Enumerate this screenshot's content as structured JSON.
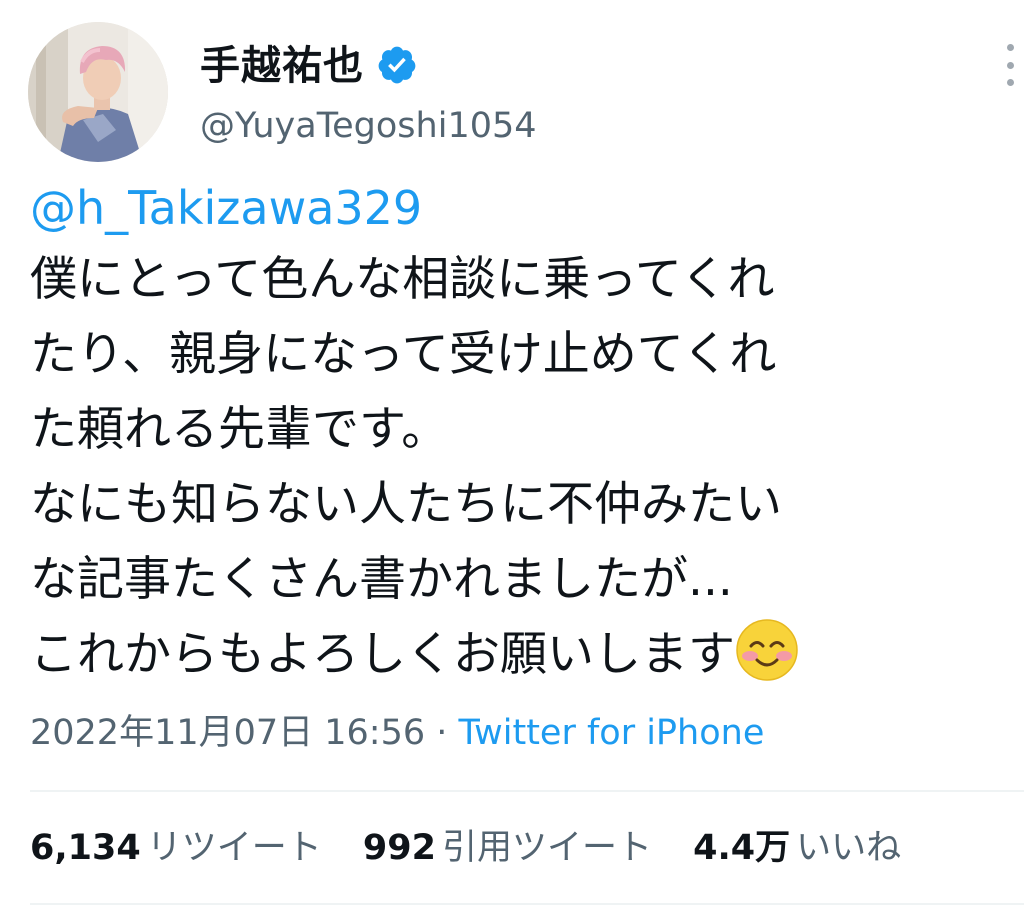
{
  "user": {
    "display_name": "手越祐也",
    "handle": "@YuyaTegoshi1054",
    "verified": true,
    "verified_icon": "verified-badge-icon",
    "avatar_icon": "avatar"
  },
  "tweet": {
    "mention": "@h_Takizawa329",
    "lines": [
      "僕にとって色んな相談に乗ってくれ",
      "たり、親身になって受け止めてくれ",
      "た頼れる先輩です。",
      "なにも知らない人たちに不仲みたい",
      "な記事たくさん書かれましたが...",
      "これからもよろしくお願いします"
    ],
    "emoji": "smiling-face-icon",
    "timestamp": "2022年11月07日 16:56",
    "separator": " · ",
    "source": "Twitter for iPhone"
  },
  "stats": {
    "retweets_count": "6,134",
    "retweets_label": "リツイート",
    "quotes_count": "992",
    "quotes_label": "引用ツイート",
    "likes_count": "4.4万",
    "likes_label": "いいね"
  },
  "colors": {
    "link": "#1d9bf0",
    "secondary_text": "#536471",
    "primary_text": "#0f1419",
    "divider": "#eff3f4"
  }
}
